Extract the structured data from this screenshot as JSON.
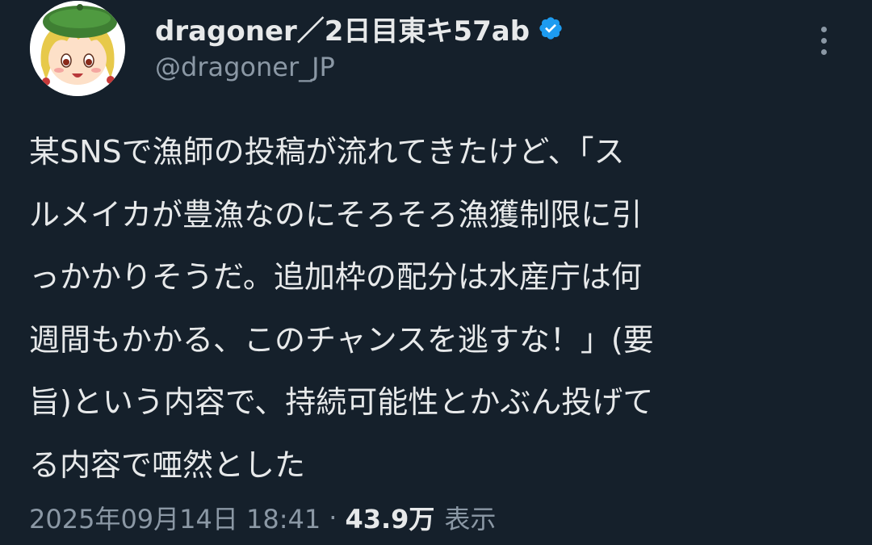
{
  "author": {
    "display_name": "dragoner／2日目東キ57ab",
    "handle": "@dragoner_JP",
    "verified": true,
    "avatar_icon": "yukkuri-avatar-icon",
    "more_icon": "more-vertical-icon"
  },
  "tweet": {
    "lines": [
      "某SNSで漁師の投稿が流れてきたけど、「ス",
      "ルメイカが豊漁なのにそろそろ漁獲制限に引",
      "っかかりそうだ。追加枠の配分は水産庁は何",
      "週間もかかる、このチャンスを逃すな！」(要",
      "旨)という内容で、持続可能性とかぶん投げて",
      "る内容で唖然とした"
    ]
  },
  "meta": {
    "timestamp": "2025年09月14日 18:41",
    "separator": "·",
    "views_count": "43.9万",
    "views_label": "表示"
  },
  "colors": {
    "background": "#15202b",
    "text_primary": "#e7e9ea",
    "text_secondary": "#8b98a5",
    "verified_blue": "#1d9bf0"
  }
}
